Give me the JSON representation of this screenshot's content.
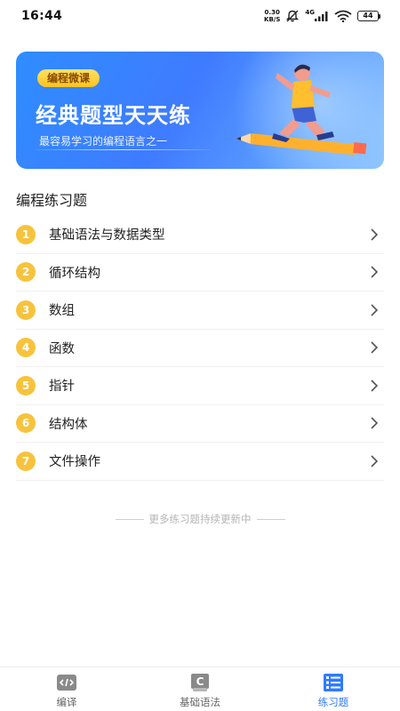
{
  "status_bar": {
    "time": "16:44",
    "net_speed_value": "0.30",
    "net_speed_unit": "KB/S",
    "network_type": "4G",
    "battery": "44",
    "icons": [
      "mute-icon",
      "signal-icon",
      "wifi-icon",
      "battery-icon"
    ]
  },
  "banner": {
    "badge": "编程微课",
    "title": "经典题型天天练",
    "subtitle": "最容易学习的编程语言之一",
    "colors": {
      "start": "#2f8dff",
      "end": "#8fc6ff",
      "badge": "#ffc31e"
    }
  },
  "section": {
    "title": "编程练习题"
  },
  "exercises": [
    {
      "num": "1",
      "label": "基础语法与数据类型"
    },
    {
      "num": "2",
      "label": "循环结构"
    },
    {
      "num": "3",
      "label": "数组"
    },
    {
      "num": "4",
      "label": "函数"
    },
    {
      "num": "5",
      "label": "指针"
    },
    {
      "num": "6",
      "label": "结构体"
    },
    {
      "num": "7",
      "label": "文件操作"
    }
  ],
  "footer_note": "更多练习题持续更新中",
  "bottom_nav": {
    "items": [
      {
        "label": "编译",
        "icon": "code-icon",
        "active": false
      },
      {
        "label": "基础语法",
        "icon": "c-book-icon",
        "active": false
      },
      {
        "label": "练习题",
        "icon": "list-icon",
        "active": true
      }
    ],
    "active_color": "#2f7bff"
  }
}
